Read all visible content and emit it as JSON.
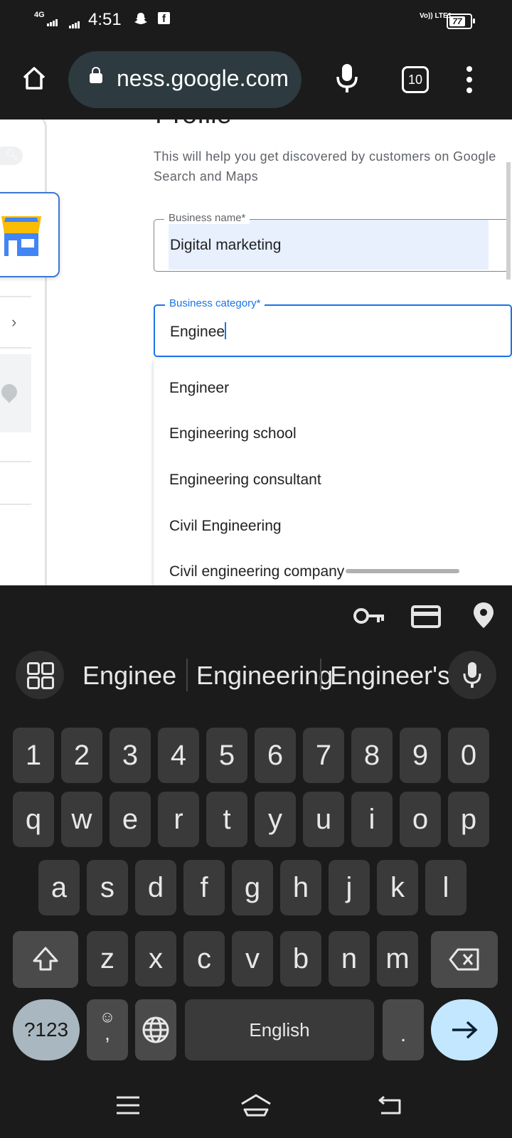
{
  "status_bar": {
    "network": "4G",
    "time": "4:51",
    "volte": "Vo)) LTE1",
    "battery": "77"
  },
  "browser": {
    "url": "ness.google.com",
    "tab_count": "10"
  },
  "page": {
    "title": "Profile",
    "subtitle": "This will help you get discovered by customers on Google Search and Maps",
    "business_name": {
      "label": "Business name*",
      "value": "Digital marketing"
    },
    "business_category": {
      "label": "Business category*",
      "value": "Enginee"
    },
    "options": [
      "Engineer",
      "Engineering school",
      "Engineering consultant",
      "Civil Engineering",
      "Civil engineering company"
    ]
  },
  "keyboard": {
    "suggestions": [
      "Enginee",
      "Engineering",
      "Engineer's"
    ],
    "row_numbers": [
      "1",
      "2",
      "3",
      "4",
      "5",
      "6",
      "7",
      "8",
      "9",
      "0"
    ],
    "row1": [
      "q",
      "w",
      "e",
      "r",
      "t",
      "y",
      "u",
      "i",
      "o",
      "p"
    ],
    "row2": [
      "a",
      "s",
      "d",
      "f",
      "g",
      "h",
      "j",
      "k",
      "l"
    ],
    "row3": [
      "z",
      "x",
      "c",
      "v",
      "b",
      "n",
      "m"
    ],
    "symbols_key": "?123",
    "comma_key": ",",
    "space_key": "English",
    "period_key": "."
  },
  "colors": {
    "accent": "#1a73e8",
    "enter_key": "#c2e7ff",
    "highlight": "#e8f0fe"
  }
}
